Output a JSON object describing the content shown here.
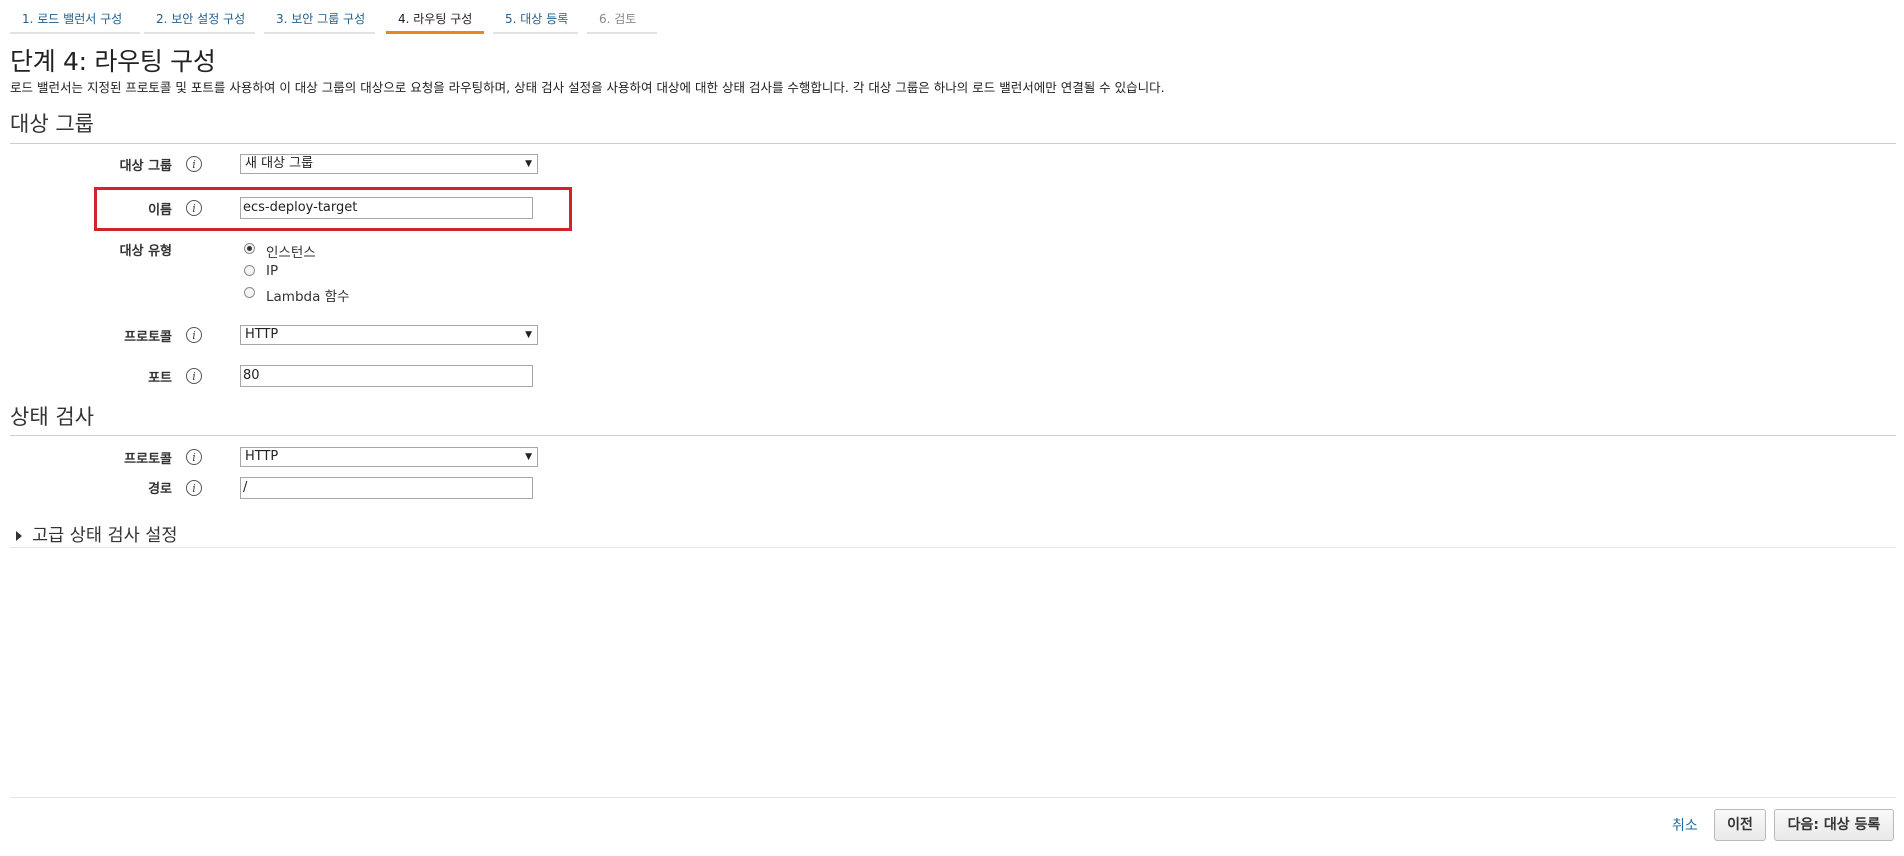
{
  "wizard": {
    "steps": [
      {
        "label": "1. 로드 밸런서 구성"
      },
      {
        "label": "2. 보안 설정 구성"
      },
      {
        "label": "3. 보안 그룹 구성"
      },
      {
        "label": "4. 라우팅 구성"
      },
      {
        "label": "5. 대상 등록"
      },
      {
        "label": "6. 검토"
      }
    ],
    "active_step": 4
  },
  "page": {
    "title": "단계 4: 라우팅 구성",
    "description": "로드 밸런서는 지정된 프로토콜 및 포트를 사용하여 이 대상 그룹의 대상으로 요청을 라우팅하며, 상태 검사 설정을 사용하여 대상에 대한 상태 검사를 수행합니다. 각 대상 그룹은 하나의 로드 밸런서에만 연결될 수 있습니다."
  },
  "target_group": {
    "section_title": "대상 그룹",
    "target_group_label": "대상 그룹",
    "target_group_value": "새 대상 그룹",
    "name_label": "이름",
    "name_value": "ecs-deploy-target",
    "target_type_label": "대상 유형",
    "target_type_options": [
      {
        "label": "인스턴스",
        "checked": true
      },
      {
        "label": "IP",
        "checked": false
      },
      {
        "label": "Lambda 함수",
        "checked": false
      }
    ],
    "protocol_label": "프로토콜",
    "protocol_value": "HTTP",
    "port_label": "포트",
    "port_value": "80"
  },
  "health_check": {
    "section_title": "상태 검사",
    "protocol_label": "프로토콜",
    "protocol_value": "HTTP",
    "path_label": "경로",
    "path_value": "/",
    "advanced_label": "고급 상태 검사 설정"
  },
  "footer": {
    "cancel_label": "취소",
    "previous_label": "이전",
    "next_label": "다음: 대상 등록"
  },
  "icons": {
    "info": "info-icon",
    "dropdown": "dropdown-arrow-icon",
    "expand": "caret-right-icon"
  },
  "colors": {
    "active_tab_underline": "#e7881c",
    "link": "#1f6fa8",
    "highlight_box": "#d2232a"
  }
}
